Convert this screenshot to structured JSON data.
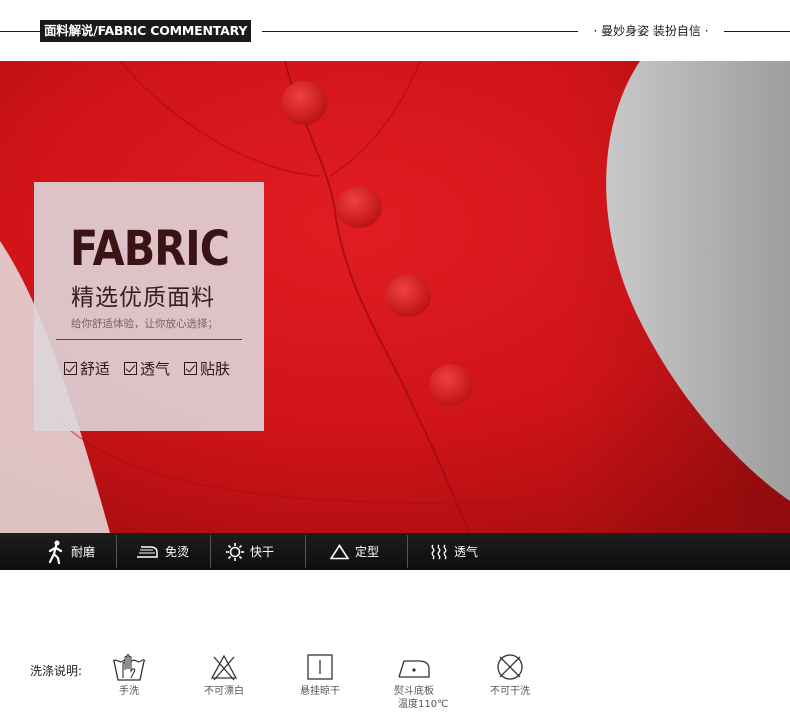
{
  "header": {
    "title": "面料解说/FABRIC COMMENTARY",
    "slogan": "· 曼妙身姿 装扮自信 ·"
  },
  "photo": {
    "subject": "red wool fabric with buttons",
    "fabric_color": "#d7161a",
    "card": {
      "heading": "FABRIC",
      "title": "精选优质面料",
      "subtitle": "给你舒适体验，让你放心选择；",
      "features": [
        "舒适",
        "透气",
        "贴肤"
      ]
    }
  },
  "feature_bar": {
    "items": [
      {
        "label": "耐磨",
        "icon": "walking-figure-icon"
      },
      {
        "label": "免烫",
        "icon": "iron-icon"
      },
      {
        "label": "快干",
        "icon": "sun-icon"
      },
      {
        "label": "定型",
        "icon": "triangle-icon"
      },
      {
        "label": "透气",
        "icon": "waves-icon"
      }
    ]
  },
  "wash": {
    "label": "洗涤说明:",
    "items": [
      {
        "name": "手洗",
        "icon": "hand-wash-icon"
      },
      {
        "name": "不可漂白",
        "icon": "no-bleach-icon"
      },
      {
        "name": "悬挂晾干",
        "icon": "hang-dry-icon"
      },
      {
        "name": "熨斗底板",
        "extra": "温度110℃",
        "icon": "iron-temp-icon"
      },
      {
        "name": "不可干洗",
        "icon": "no-dry-clean-icon"
      }
    ]
  }
}
